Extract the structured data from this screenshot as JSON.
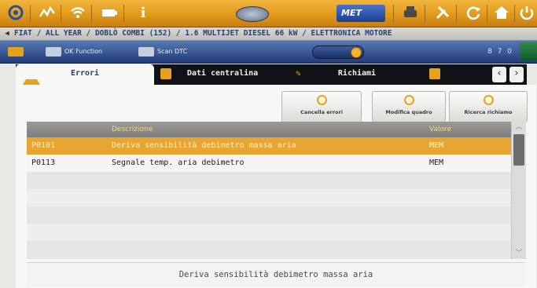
{
  "toolbar": {
    "met_label": "MET",
    "icons": [
      "home-icon",
      "chart-icon",
      "wifi-icon",
      "battery-icon",
      "info-icon",
      "car-logo",
      "met-icon",
      "printer-icon",
      "tools-icon",
      "refresh-icon",
      "house-icon",
      "power-icon"
    ]
  },
  "breadcrumb": {
    "text": "FIAT / ALL YEAR / DOBLÒ COMBI (152) / 1.6 MULTIJET DIESEL 66 kW / ELETTRONICA MOTORE"
  },
  "function_row": {
    "ok_function": "OK Function",
    "scan_dtc": "Scan DTC",
    "right_text": "8 7 0"
  },
  "tabs": [
    {
      "label": "Errori",
      "active": true
    },
    {
      "label": "Dati centralina",
      "active": false
    },
    {
      "label": "Richiami",
      "active": false
    },
    {
      "label": "",
      "active": false
    }
  ],
  "actions": {
    "cancella": "Cancella errori",
    "modifica": "Modifica quadro",
    "ricerca": "Ricerca richiamo"
  },
  "table": {
    "headers": {
      "code": "",
      "description": "Descrizione",
      "value": "Valore"
    },
    "rows": [
      {
        "code": "P0101",
        "description": "Deriva sensibilità debimetro massa aria",
        "value": "MEM"
      },
      {
        "code": "P0113",
        "description": "Segnale temp. aria debimetro",
        "value": "MEM"
      }
    ],
    "selected_index": 0
  },
  "status": {
    "text": "Deriva sensibilità debimetro massa aria"
  },
  "colors": {
    "accent": "#e8a11d",
    "nav_blue": "#233c78"
  }
}
